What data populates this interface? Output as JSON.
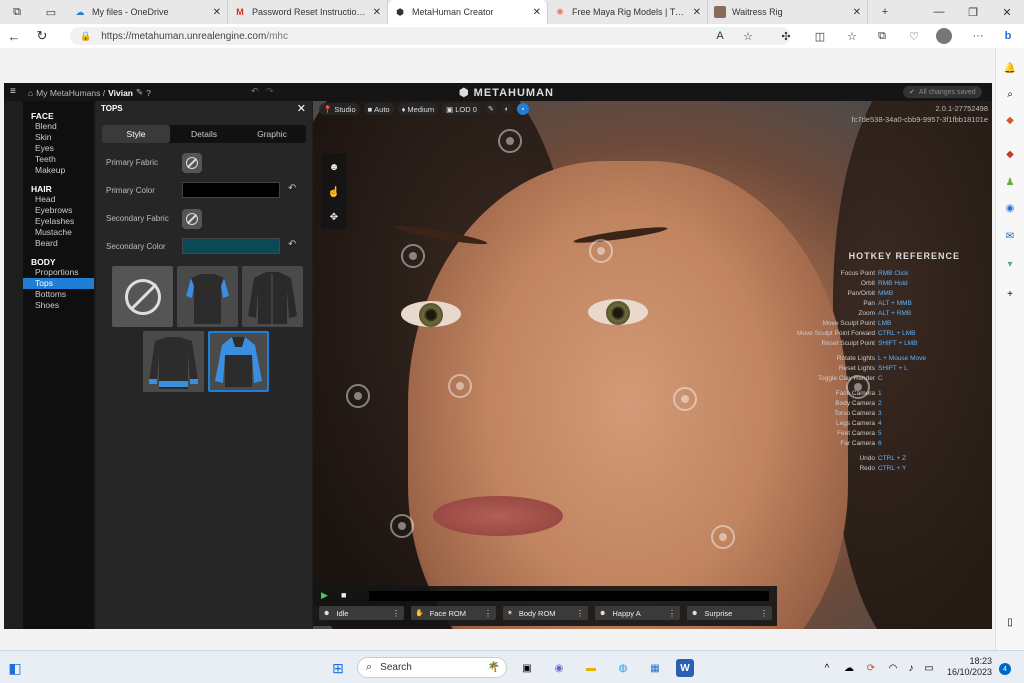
{
  "browser": {
    "tabs": [
      {
        "label": "My files - OneDrive",
        "icon": "onedrive-icon"
      },
      {
        "label": "Password Reset Instructions Fo",
        "icon": "gmail-icon"
      },
      {
        "label": "MetaHuman Creator",
        "icon": "unreal-icon",
        "active": true
      },
      {
        "label": "Free Maya Rig Models | Turbos",
        "icon": "turbosquid-icon"
      },
      {
        "label": "Waitress Rig",
        "icon": "page-icon"
      }
    ],
    "url_host": "https://metahuman.unrealengine.com",
    "url_path": "/mhc"
  },
  "app": {
    "breadcrumb_root": "My MetaHumans /",
    "character_name": "Vivian",
    "logo": "METAHUMAN",
    "saved_status": "All changes saved",
    "nav": {
      "sections": [
        {
          "title": "FACE",
          "items": [
            "Blend",
            "Skin",
            "Eyes",
            "Teeth",
            "Makeup"
          ]
        },
        {
          "title": "HAIR",
          "items": [
            "Head",
            "Eyebrows",
            "Eyelashes",
            "Mustache",
            "Beard"
          ]
        },
        {
          "title": "BODY",
          "items": [
            "Proportions",
            "Tops",
            "Bottoms",
            "Shoes"
          ]
        }
      ],
      "active": "Tops"
    },
    "panel": {
      "title": "TOPS",
      "tabs": [
        "Style",
        "Details",
        "Graphic"
      ],
      "active_tab": "Style",
      "primary_fabric_label": "Primary Fabric",
      "primary_color_label": "Primary Color",
      "secondary_fabric_label": "Secondary Fabric",
      "secondary_color_label": "Secondary Color",
      "primary_color": "#000000",
      "secondary_color": "#0b4a55"
    },
    "viewport": {
      "chips": [
        "Studio",
        "Auto",
        "Medium",
        "LOD 0"
      ],
      "version": "2.0.1-27752498",
      "build_id": "fc7de538-34a0-cbb9-9957-3f1fbb18101e",
      "hotkey_title": "HOTKEY REFERENCE",
      "hotkeys": [
        [
          "Focus Point",
          "RMB Click"
        ],
        [
          "Orbit",
          "RMB Hold"
        ],
        [
          "Pan/Orbit",
          "MMB"
        ],
        [
          "Pan",
          "ALT + MMB"
        ],
        [
          "Zoom",
          "ALT + RMB"
        ],
        [
          "Move Sculpt Point",
          "LMB"
        ],
        [
          "Move Sculpt Point Forward",
          "CTRL + LMB"
        ],
        [
          "Reset Sculpt Point",
          "SHIFT + LMB"
        ],
        [
          "",
          ""
        ],
        [
          "Rotate Lights",
          "L + Mouse Move"
        ],
        [
          "Reset Lights",
          "SHIFT + L"
        ],
        [
          "Toggle Clay Render",
          "C"
        ],
        [
          "",
          ""
        ],
        [
          "Face Camera",
          "1"
        ],
        [
          "Body Camera",
          "2"
        ],
        [
          "Torso Camera",
          "3"
        ],
        [
          "Legs Camera",
          "4"
        ],
        [
          "Feet Camera",
          "5"
        ],
        [
          "Far Camera",
          "6"
        ],
        [
          "",
          ""
        ],
        [
          "Undo",
          "CTRL + Z"
        ],
        [
          "Redo",
          "CTRL + Y"
        ]
      ],
      "animations": [
        "Idle",
        "Face ROM",
        "Body ROM",
        "Happy A",
        "Surprise"
      ]
    }
  },
  "taskbar": {
    "search_placeholder": "Search",
    "time": "18:23",
    "date": "16/10/2023",
    "notifications": "4"
  }
}
